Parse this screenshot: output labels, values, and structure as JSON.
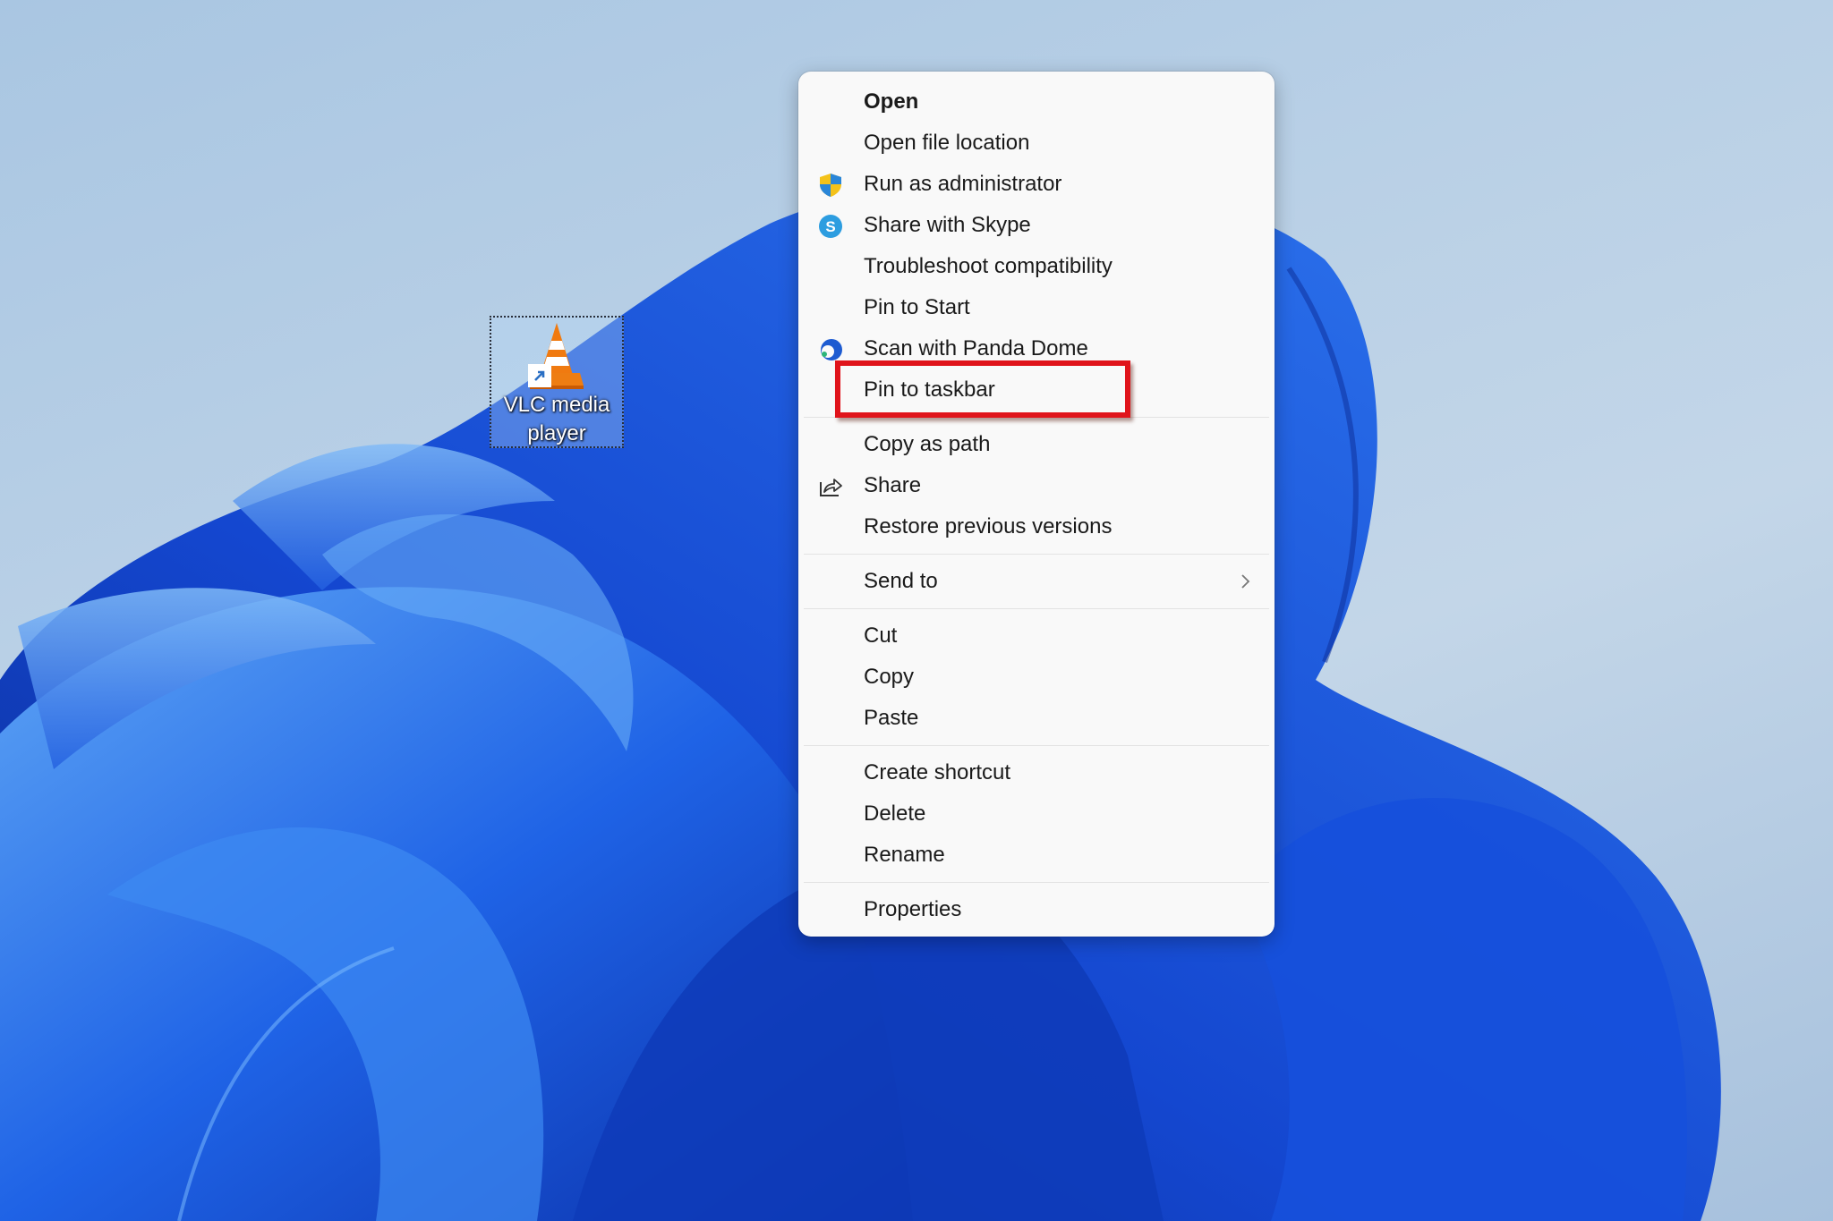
{
  "desktop": {
    "icon": {
      "label": "VLC media player",
      "icon_name": "vlc-cone-icon",
      "overlay_icon": "shortcut-arrow-icon"
    }
  },
  "context_menu": {
    "groups": [
      [
        {
          "label": "Open",
          "icon": null,
          "bold": true
        },
        {
          "label": "Open file location",
          "icon": null
        },
        {
          "label": "Run as administrator",
          "icon": "uac-shield-icon"
        },
        {
          "label": "Share with Skype",
          "icon": "skype-icon"
        },
        {
          "label": "Troubleshoot compatibility",
          "icon": null
        },
        {
          "label": "Pin to Start",
          "icon": null
        },
        {
          "label": "Scan with Panda Dome",
          "icon": "panda-dome-icon"
        },
        {
          "label": "Pin to taskbar",
          "icon": null,
          "highlighted": true
        }
      ],
      [
        {
          "label": "Copy as path",
          "icon": null
        },
        {
          "label": "Share",
          "icon": "share-icon"
        },
        {
          "label": "Restore previous versions",
          "icon": null
        }
      ],
      [
        {
          "label": "Send to",
          "icon": null,
          "submenu": true
        }
      ],
      [
        {
          "label": "Cut",
          "icon": null
        },
        {
          "label": "Copy",
          "icon": null
        },
        {
          "label": "Paste",
          "icon": null
        }
      ],
      [
        {
          "label": "Create shortcut",
          "icon": null
        },
        {
          "label": "Delete",
          "icon": null
        },
        {
          "label": "Rename",
          "icon": null
        }
      ],
      [
        {
          "label": "Properties",
          "icon": null
        }
      ]
    ]
  },
  "annotation": {
    "highlight_target": "Pin to taskbar",
    "highlight_color": "#e0141b"
  },
  "colors": {
    "menu_bg": "#f9f9f9",
    "menu_text": "#1a1a1a",
    "separator": "#e3e3e3",
    "wallpaper_blue": "#1a5be0"
  }
}
